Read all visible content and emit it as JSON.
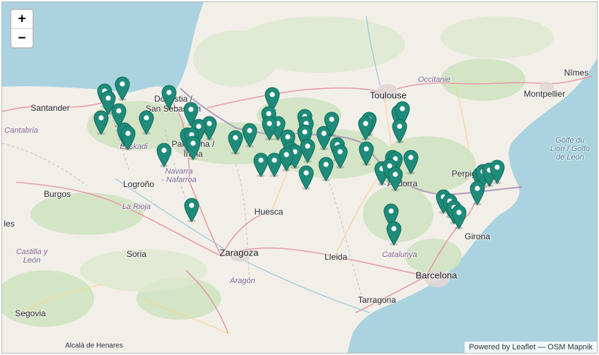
{
  "controls": {
    "zoom_in": "+",
    "zoom_out": "−"
  },
  "attribution": {
    "powered_by": "Powered by",
    "leaflet": "Leaflet",
    "separator": " — ",
    "tiles": "OSM Mapnik"
  },
  "marker_color": "#1f8b7a",
  "labels": {
    "toulouse": "Toulouse",
    "occitanie": "Occitanie",
    "montpellier": "Montpellier",
    "nimes": "Nîmes",
    "golfe": "Golfe du\nLion / Golfo\nde León",
    "santander": "Santander",
    "cantabria": "Cantabria",
    "donostia": "Donostia /\nSan Sebastián",
    "pamplona": "Pamplona /\nIruña",
    "navarra": "Navarra\n- Nafarroa",
    "euskadi": "Euskadi",
    "burgos": "Burgos",
    "logrono": "Logroño",
    "larioja": "La Rioja",
    "huesca": "Huesca",
    "zaragoza": "Zaragoza",
    "aragon": "Aragón",
    "lleida": "Lleida",
    "catalunya": "Catalunya",
    "andorra": "Andorra",
    "girona": "Girona",
    "barcelona": "Barcelona",
    "tarragona": "Tarragona",
    "soria": "Soria",
    "segovia": "Segovia",
    "castilla": "Castilla y\nLeón",
    "alcala": "Alcalá de Henares",
    "perpignan": "Perpignan",
    "les": "les"
  }
}
